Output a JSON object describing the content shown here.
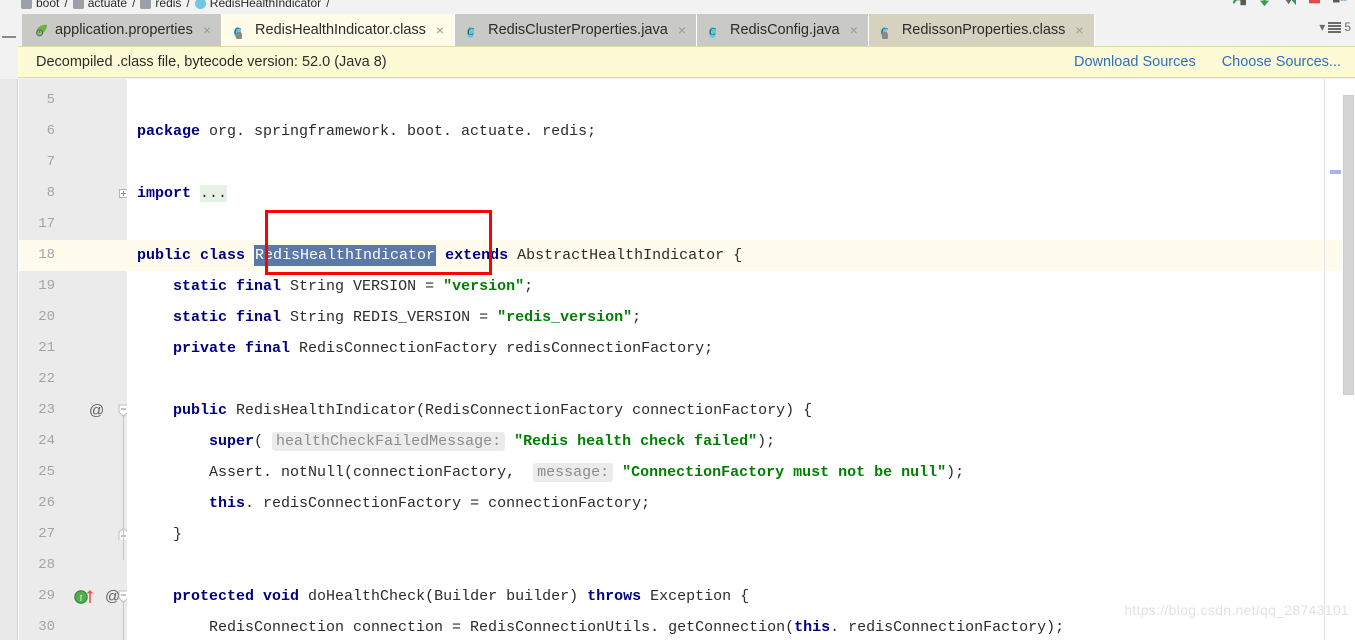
{
  "breadcrumb": {
    "items": [
      "boot",
      "actuate",
      "redis",
      "RedisHealthIndicator"
    ],
    "separator": "/"
  },
  "toolbar": {
    "icons": [
      "debug-step-over-icon",
      "debug-step-into-icon",
      "debug-step-out-icon",
      "stop-icon",
      "layout-icon"
    ]
  },
  "tabs": {
    "items": [
      {
        "label": "application.properties",
        "icon": "spring-leaf-icon",
        "close": "×",
        "state": "inactive"
      },
      {
        "label": "RedisHealthIndicator.class",
        "icon": "class-locked-icon",
        "close": "×",
        "state": "active"
      },
      {
        "label": "RedisClusterProperties.java",
        "icon": "class-icon",
        "close": "×",
        "state": "inactive"
      },
      {
        "label": "RedisConfig.java",
        "icon": "class-icon",
        "close": "×",
        "state": "inactive"
      },
      {
        "label": "RedissonProperties.class",
        "icon": "class-locked-icon",
        "close": "×",
        "state": "dim"
      }
    ],
    "overflow_count": "5",
    "overflow_caret": "▾"
  },
  "banner": {
    "message": "Decompiled .class file, bytecode version: 52.0 (Java 8)",
    "download_sources": "Download Sources",
    "choose_sources": "Choose Sources..."
  },
  "editor": {
    "selected_text": "RedisHealthIndicator",
    "watermark": "https://blog.csdn.net/qq_28743101",
    "lines": [
      {
        "num": "5",
        "segments": []
      },
      {
        "num": "6",
        "segments": [
          {
            "t": "package ",
            "c": "kw"
          },
          {
            "t": "org. springframework. boot. actuate. redis;",
            "c": "plain"
          }
        ]
      },
      {
        "num": "7",
        "segments": []
      },
      {
        "num": "8",
        "gutter_icon": "fold-plus-icon",
        "segments": [
          {
            "t": "import ",
            "c": "kw"
          },
          {
            "t": "...",
            "c": "greenfold"
          }
        ]
      },
      {
        "num": "17",
        "segments": []
      },
      {
        "num": "18",
        "current": true,
        "segments": [
          {
            "t": "public class ",
            "c": "kw"
          },
          {
            "t": "RedisHealthIndicator",
            "c": "sel"
          },
          {
            "t": " ",
            "c": "plain"
          },
          {
            "t": "extends ",
            "c": "kw"
          },
          {
            "t": "AbstractHealthIndicator {",
            "c": "plain"
          }
        ]
      },
      {
        "num": "19",
        "segments": [
          {
            "t": "    ",
            "c": "plain"
          },
          {
            "t": "static final ",
            "c": "kw"
          },
          {
            "t": "String VERSION = ",
            "c": "plain"
          },
          {
            "t": "\"version\"",
            "c": "str"
          },
          {
            "t": ";",
            "c": "plain"
          }
        ]
      },
      {
        "num": "20",
        "segments": [
          {
            "t": "    ",
            "c": "plain"
          },
          {
            "t": "static final ",
            "c": "kw"
          },
          {
            "t": "String REDIS_VERSION = ",
            "c": "plain"
          },
          {
            "t": "\"redis_version\"",
            "c": "str"
          },
          {
            "t": ";",
            "c": "plain"
          }
        ]
      },
      {
        "num": "21",
        "segments": [
          {
            "t": "    ",
            "c": "plain"
          },
          {
            "t": "private final ",
            "c": "kw"
          },
          {
            "t": "RedisConnectionFactory redisConnectionFactory;",
            "c": "plain"
          }
        ]
      },
      {
        "num": "22",
        "segments": []
      },
      {
        "num": "23",
        "gutter_icon": "annotation-at-icon",
        "fold": "fold-collapse-icon",
        "segments": [
          {
            "t": "    ",
            "c": "plain"
          },
          {
            "t": "public ",
            "c": "kw"
          },
          {
            "t": "RedisHealthIndicator(RedisConnectionFactory connectionFactory) {",
            "c": "plain"
          }
        ]
      },
      {
        "num": "24",
        "segments": [
          {
            "t": "        ",
            "c": "plain"
          },
          {
            "t": "super",
            "c": "kw"
          },
          {
            "t": "( ",
            "c": "plain"
          },
          {
            "t": "healthCheckFailedMessage:",
            "c": "hintchip"
          },
          {
            "t": " ",
            "c": "plain"
          },
          {
            "t": "\"Redis health check failed\"",
            "c": "str"
          },
          {
            "t": ");",
            "c": "plain"
          }
        ]
      },
      {
        "num": "25",
        "segments": [
          {
            "t": "        ",
            "c": "plain"
          },
          {
            "t": "Assert. notNull(connectionFactory,  ",
            "c": "plain"
          },
          {
            "t": "message:",
            "c": "hintchip"
          },
          {
            "t": " ",
            "c": "plain"
          },
          {
            "t": "\"ConnectionFactory must not be null\"",
            "c": "str"
          },
          {
            "t": ");",
            "c": "plain"
          }
        ]
      },
      {
        "num": "26",
        "segments": [
          {
            "t": "        ",
            "c": "plain"
          },
          {
            "t": "this",
            "c": "kw"
          },
          {
            "t": ". redisConnectionFactory = connectionFactory;",
            "c": "plain"
          }
        ]
      },
      {
        "num": "27",
        "fold": "fold-end-icon",
        "segments": [
          {
            "t": "    }",
            "c": "plain"
          }
        ]
      },
      {
        "num": "28",
        "segments": []
      },
      {
        "num": "29",
        "gutter_icon": "override-method-icon",
        "gutter_icon2": "annotation-at-icon",
        "fold": "fold-collapse-icon",
        "segments": [
          {
            "t": "    ",
            "c": "plain"
          },
          {
            "t": "protected void ",
            "c": "kw"
          },
          {
            "t": "doHealthCheck(Builder builder) ",
            "c": "plain"
          },
          {
            "t": "throws ",
            "c": "kw"
          },
          {
            "t": "Exception {",
            "c": "plain"
          }
        ]
      },
      {
        "num": "30",
        "segments": [
          {
            "t": "        ",
            "c": "plain"
          },
          {
            "t": "RedisConnection connection = RedisConnectionUtils. getConnection(",
            "c": "plain"
          },
          {
            "t": "this",
            "c": "kw"
          },
          {
            "t": ". redisConnectionFactory);",
            "c": "plain"
          }
        ]
      }
    ]
  },
  "colors": {
    "keyword": "#000080",
    "string": "#008000",
    "selection": "#5a78a8",
    "current_line": "#fffced",
    "banner_bg": "#fdfbd6",
    "link": "#2f6fc0",
    "annotation_box": "#ff0000"
  }
}
